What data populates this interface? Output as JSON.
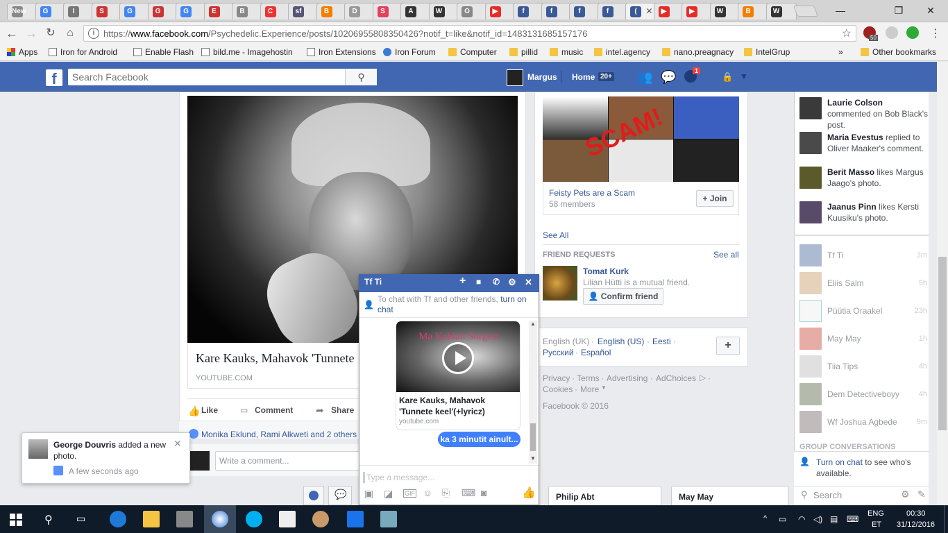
{
  "browser": {
    "tabs": [
      {
        "label": "New",
        "color": "#888"
      },
      {
        "label": "G",
        "color": "#4285f4"
      },
      {
        "label": "I",
        "color": "#777"
      },
      {
        "label": "S",
        "color": "#c33"
      },
      {
        "label": "G",
        "color": "#4285f4"
      },
      {
        "label": "G",
        "color": "#c33"
      },
      {
        "label": "G",
        "color": "#4285f4"
      },
      {
        "label": "E",
        "color": "#c33"
      },
      {
        "label": "B",
        "color": "#888"
      },
      {
        "label": "C",
        "color": "#e33"
      },
      {
        "label": "sf",
        "color": "#557"
      },
      {
        "label": "B",
        "color": "#f57d00"
      },
      {
        "label": "D",
        "color": "#999"
      },
      {
        "label": "S",
        "color": "#e4405f"
      },
      {
        "label": "A",
        "color": "#333"
      },
      {
        "label": "W",
        "color": "#333"
      },
      {
        "label": "O",
        "color": "#888"
      },
      {
        "label": "▶",
        "color": "#e52d27"
      },
      {
        "label": "f",
        "color": "#3b5998"
      },
      {
        "label": "f",
        "color": "#3b5998"
      },
      {
        "label": "f",
        "color": "#3b5998"
      },
      {
        "label": "f",
        "color": "#3b5998"
      },
      {
        "label": "(",
        "color": "#3b5998"
      },
      {
        "label": "▶",
        "color": "#e52d27"
      },
      {
        "label": "▶",
        "color": "#e52d27"
      },
      {
        "label": "W",
        "color": "#333"
      },
      {
        "label": "B",
        "color": "#f57d00"
      },
      {
        "label": "W",
        "color": "#333"
      }
    ],
    "first_tab_text": "New",
    "url": "https://www.facebook.com/Psychedelic.Experience/posts/10206955808350426?notif_t=like&notif_id=1483131685157176",
    "url_scheme": "https://",
    "url_host": "www.facebook.com",
    "url_path": "/Psychedelic.Experience/posts/10206955808350426?notif_t=like&notif_id=1483131685157176",
    "ext_badge": "50"
  },
  "bookmarks": {
    "apps": "Apps",
    "items": [
      "Iron for Android",
      "Enable Flash",
      "bild.me - Imagehostin",
      "Iron Extensions",
      "Iron Forum",
      "Computer",
      "pillid",
      "music",
      "intel.agency",
      "nano.preagnacy",
      "IntelGrup"
    ],
    "more": "»",
    "other": "Other bookmarks"
  },
  "fb": {
    "search_placeholder": "Search Facebook",
    "user": "Margus",
    "home": "Home",
    "home_count": "20+",
    "notif_count": "1"
  },
  "post": {
    "title": "Kare Kauks, Mahavok 'Tunnete",
    "source": "YOUTUBE.COM",
    "like": "Like",
    "comment": "Comment",
    "share": "Share",
    "reactions": "Monika Eklund, Rami Alkweti and 2 others",
    "comment_placeholder": "Write a comment..."
  },
  "right": {
    "group_name": "Feisty Pets are a Scam",
    "group_members": "58 members",
    "scam_text": "SCAM!",
    "join": "Join",
    "see_all": "See All",
    "friend_requests": "FRIEND REQUESTS",
    "see_all_requests": "See all",
    "friend_name": "Tomat Kurk",
    "friend_mutual": "Lilian Hütti is a mutual friend.",
    "confirm": "Confirm friend",
    "languages": [
      "English (UK)",
      "English (US)",
      "Eesti",
      "Русский",
      "Español"
    ],
    "footer1": [
      "Privacy",
      "Terms",
      "Advertising",
      "AdChoices",
      "Cookies",
      "More"
    ],
    "copyright": "Facebook © 2016"
  },
  "ticker": {
    "items": [
      {
        "name": "Laurie Colson",
        "rest": " commented on Bob Black's post."
      },
      {
        "name": "Maria Evestus",
        "rest": " replied to Oliver Maaker's comment."
      },
      {
        "name": "Berit Masso",
        "rest": " likes Margus Jaago's photo."
      },
      {
        "name": "Jaanus Pinn",
        "rest": " likes Kersti Kuusiku's photo."
      }
    ],
    "contacts": [
      {
        "name": "Tf Ti",
        "time": "3m"
      },
      {
        "name": "Eliis Salm",
        "time": "5h"
      },
      {
        "name": "Püütia Oraakel",
        "time": "23h"
      },
      {
        "name": "May May",
        "time": "1h"
      },
      {
        "name": "Tiia Tips",
        "time": "4h"
      },
      {
        "name": "Dem Detectiveboyy",
        "time": "4h"
      },
      {
        "name": "Wf Joshua Agbede",
        "time": "9m"
      }
    ],
    "group_conv": "GROUP CONVERSATIONS",
    "turn_on": "Turn on chat",
    "turn_on_rest": " to see who's available.",
    "search": "Search"
  },
  "chat": {
    "title": "Tf Ti",
    "notice": "To chat with Tf and other friends, ",
    "notice_link": "turn on chat",
    "thumb_text": "Ma Kaklan Sorgest",
    "link_title": "Kare Kauks, Mahavok 'Tunnete keel'(+lyricz)",
    "link_domain": "youtube.com",
    "message": "ka 3 minutit ainult...",
    "placeholder": "Type a message..."
  },
  "docked": {
    "chat1": "Philip Abt",
    "chat2": "May May"
  },
  "notification": {
    "name": "George Douvris",
    "rest": " added a new photo.",
    "time": "A few seconds ago"
  },
  "taskbar": {
    "lang": "ENG",
    "layout": "ET",
    "time": "00:30",
    "date": "31/12/2016"
  }
}
